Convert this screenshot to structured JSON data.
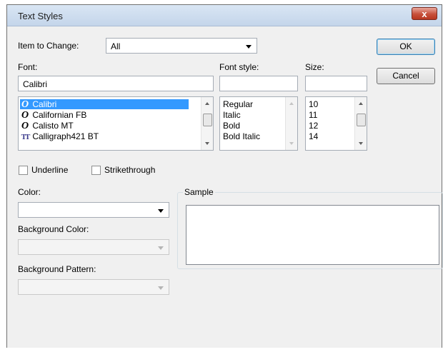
{
  "window": {
    "title": "Text Styles",
    "close_label": "x"
  },
  "item_to_change": {
    "label": "Item to Change:",
    "value": "All"
  },
  "buttons": {
    "ok": "OK",
    "cancel": "Cancel"
  },
  "font": {
    "label": "Font:",
    "value": "Calibri",
    "items": [
      {
        "icon": "O",
        "icon_type": "opentype-font-icon",
        "name": "Calibri",
        "selected": true
      },
      {
        "icon": "O",
        "icon_type": "opentype-font-icon",
        "name": "Californian FB"
      },
      {
        "icon": "O",
        "icon_type": "opentype-font-icon",
        "name": "Calisto MT"
      },
      {
        "icon": "TT",
        "icon_type": "truetype-font-icon",
        "name": "Calligraph421 BT"
      }
    ]
  },
  "font_style": {
    "label": "Font style:",
    "value": "",
    "items": [
      "Regular",
      "Italic",
      "Bold",
      "Bold Italic"
    ]
  },
  "size": {
    "label": "Size:",
    "value": "",
    "items": [
      "10",
      "11",
      "12",
      "14"
    ]
  },
  "effects": {
    "underline": "Underline",
    "strikethrough": "Strikethrough",
    "underline_checked": false,
    "strikethrough_checked": false
  },
  "color": {
    "label": "Color:",
    "value": ""
  },
  "background_color": {
    "label": "Background Color:",
    "value": ""
  },
  "background_pattern": {
    "label": "Background Pattern:",
    "value": ""
  },
  "sample": {
    "label": "Sample"
  },
  "colors": {
    "selection": "#3399ff",
    "close_button": "#c7503b",
    "dialog_bg": "#f0f0f0"
  }
}
